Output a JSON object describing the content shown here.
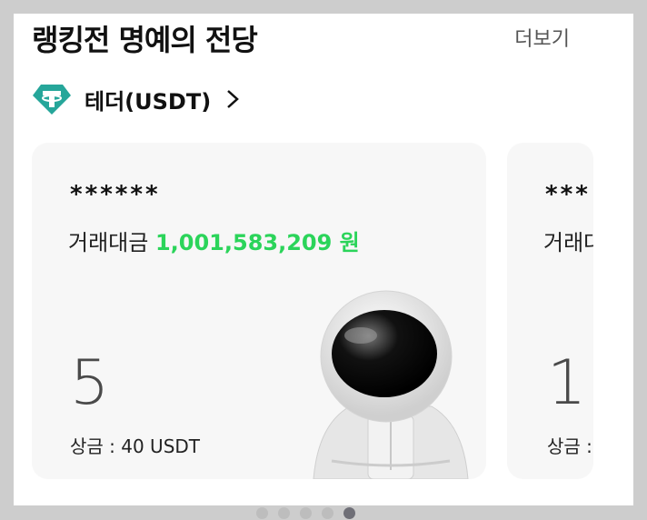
{
  "header": {
    "title": "랭킹전 명예의 전당",
    "more_label": "더보기"
  },
  "coin": {
    "name": "테더(USDT)",
    "icon": "tether-icon"
  },
  "cards": [
    {
      "masked_name": "******",
      "volume_label": "거래대금",
      "volume_value": "1,001,583,209 원",
      "rank": "5",
      "prize": "상금 : 40 USDT"
    },
    {
      "masked_name": "***",
      "volume_label": "거래대",
      "rank": "1",
      "prize": "상금 :"
    }
  ],
  "pagination": {
    "count": 5,
    "active_index": 4
  },
  "colors": {
    "accent_green": "#2bd45a",
    "tether_teal": "#26a69a"
  }
}
